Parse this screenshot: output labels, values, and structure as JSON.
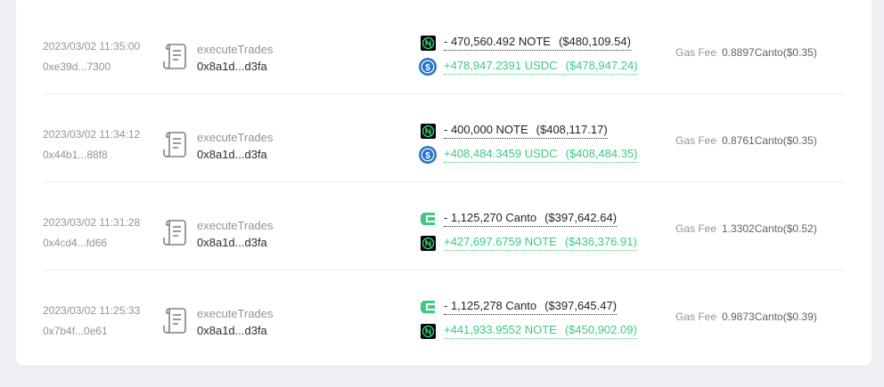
{
  "gas_label": "Gas Fee",
  "colors": {
    "note": "#000000",
    "note_accent": "#3ccb7f",
    "usdc": "#2775ca",
    "canto": "#3ccb7f",
    "in": "#3ccb7f"
  },
  "rows": [
    {
      "timestamp": "2023/03/02 11:35:00",
      "tx_hash": "0xe39d...7300",
      "method": "executeTrades",
      "address": "0x8a1d...d3fa",
      "out": {
        "icon": "note-icon",
        "amount": "- 470,560.492 NOTE",
        "usd": "($480,109.54)"
      },
      "in": {
        "icon": "usdc-icon",
        "amount": "+478,947.2391 USDC",
        "usd": "($478,947.24)"
      },
      "gas": "0.8897Canto($0.35)"
    },
    {
      "timestamp": "2023/03/02 11:34:12",
      "tx_hash": "0x44b1...88f8",
      "method": "executeTrades",
      "address": "0x8a1d...d3fa",
      "out": {
        "icon": "note-icon",
        "amount": "- 400,000 NOTE",
        "usd": "($408,117.17)"
      },
      "in": {
        "icon": "usdc-icon",
        "amount": "+408,484.3459 USDC",
        "usd": "($408,484.35)"
      },
      "gas": "0.8761Canto($0.35)"
    },
    {
      "timestamp": "2023/03/02 11:31:28",
      "tx_hash": "0x4cd4...fd66",
      "method": "executeTrades",
      "address": "0x8a1d...d3fa",
      "out": {
        "icon": "canto-icon",
        "amount": "- 1,125,270 Canto",
        "usd": "($397,642.64)"
      },
      "in": {
        "icon": "note-icon",
        "amount": "+427,697.6759 NOTE",
        "usd": "($436,376.91)"
      },
      "gas": "1.3302Canto($0.52)"
    },
    {
      "timestamp": "2023/03/02 11:25:33",
      "tx_hash": "0x7b4f...0e61",
      "method": "executeTrades",
      "address": "0x8a1d...d3fa",
      "out": {
        "icon": "canto-icon",
        "amount": "- 1,125,278 Canto",
        "usd": "($397,645.47)"
      },
      "in": {
        "icon": "note-icon",
        "amount": "+441,933.9552 NOTE",
        "usd": "($450,902.09)"
      },
      "gas": "0.9873Canto($0.39)"
    }
  ]
}
